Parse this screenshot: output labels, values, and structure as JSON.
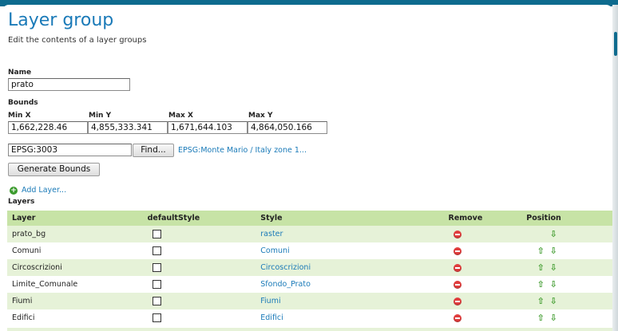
{
  "page": {
    "title": "Layer group",
    "subtitle": "Edit the contents of a layer groups"
  },
  "form": {
    "name_label": "Name",
    "name_value": "prato",
    "bounds_label": "Bounds",
    "minx_label": "Min X",
    "miny_label": "Min Y",
    "maxx_label": "Max X",
    "maxy_label": "Max Y",
    "minx": "1,662,228.46",
    "miny": "4,855,333.341",
    "maxx": "1,671,644.103",
    "maxy": "4,864,050.166",
    "crs_value": "EPSG:3003",
    "find_label": "Find...",
    "crs_link": "EPSG:Monte Mario / Italy zone 1...",
    "generate_label": "Generate Bounds",
    "add_layer_label": "Add Layer...",
    "layers_label": "Layers"
  },
  "table": {
    "headers": [
      "Layer",
      "defaultStyle",
      "Style",
      "Remove",
      "Position"
    ],
    "rows": [
      {
        "layer": "prato_bg",
        "style": "raster",
        "up": false,
        "down": true
      },
      {
        "layer": "Comuni",
        "style": "Comuni",
        "up": true,
        "down": true
      },
      {
        "layer": "Circoscrizioni",
        "style": "Circoscrizioni",
        "up": true,
        "down": true
      },
      {
        "layer": "Limite_Comunale",
        "style": "Sfondo_Prato",
        "up": true,
        "down": true
      },
      {
        "layer": "Fiumi",
        "style": "Fiumi",
        "up": true,
        "down": true
      },
      {
        "layer": "Edifici",
        "style": "Edifici",
        "up": true,
        "down": true
      }
    ]
  },
  "icons": {
    "add": "plus-circle-icon",
    "remove": "minus-circle-icon",
    "up": "arrow-up-icon",
    "down": "arrow-down-icon"
  },
  "colors": {
    "accent": "#1a7ab8",
    "header_bg": "#c7e3a6",
    "row_alt": "#e6f2d8",
    "remove": "#e03d3d",
    "arrow": "#3c9a2a"
  }
}
